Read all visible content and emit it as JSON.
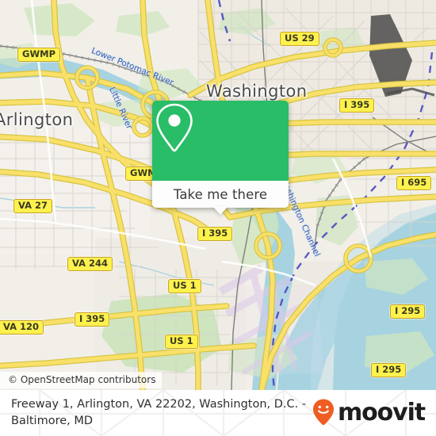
{
  "map": {
    "attribution": "© OpenStreetMap contributors",
    "city_labels": [
      {
        "name": "Washington",
        "text": "Washington"
      },
      {
        "name": "Arlington",
        "text": "Arlington"
      }
    ],
    "water_labels": [
      {
        "name": "lower-potomac-river",
        "text": "Lower Potomac River"
      },
      {
        "name": "little-river",
        "text": "Little River"
      },
      {
        "name": "washington-channel",
        "text": "Washington Channel"
      }
    ],
    "shields": [
      {
        "name": "gwmp-north",
        "text": "GWMP"
      },
      {
        "name": "gwmp-south",
        "text": "GWMP"
      },
      {
        "name": "us-29",
        "text": "US 29"
      },
      {
        "name": "i-395-north",
        "text": "I 395"
      },
      {
        "name": "i-695",
        "text": "I 695"
      },
      {
        "name": "va-27",
        "text": "VA 27"
      },
      {
        "name": "i-395-center",
        "text": "I 395"
      },
      {
        "name": "va-244",
        "text": "VA 244"
      },
      {
        "name": "us-1-north",
        "text": "US 1"
      },
      {
        "name": "i-395-west",
        "text": "I 395"
      },
      {
        "name": "va-120",
        "text": "VA 120"
      },
      {
        "name": "us-1-south",
        "text": "US 1"
      },
      {
        "name": "i-295-north",
        "text": "I 295"
      },
      {
        "name": "i-295-south",
        "text": "I 295"
      }
    ],
    "colors": {
      "land": "#f2efe9",
      "water": "#a7d3e0",
      "motorway": "#f8e06a",
      "green": "#cfe6c0",
      "shield_fill": "#fdf14e",
      "shield_border": "#c9a227"
    }
  },
  "popup": {
    "pin_icon": "map-pin-icon",
    "button_label": "Take me there",
    "accent_color": "#29bd68"
  },
  "footer": {
    "address": "Freeway 1, Arlington, VA 22202, Washington, D.C. - Baltimore, MD",
    "brand_name": "moovit",
    "brand_icon": "moovit-pin-smiley-icon",
    "brand_color": "#ef5d22"
  }
}
